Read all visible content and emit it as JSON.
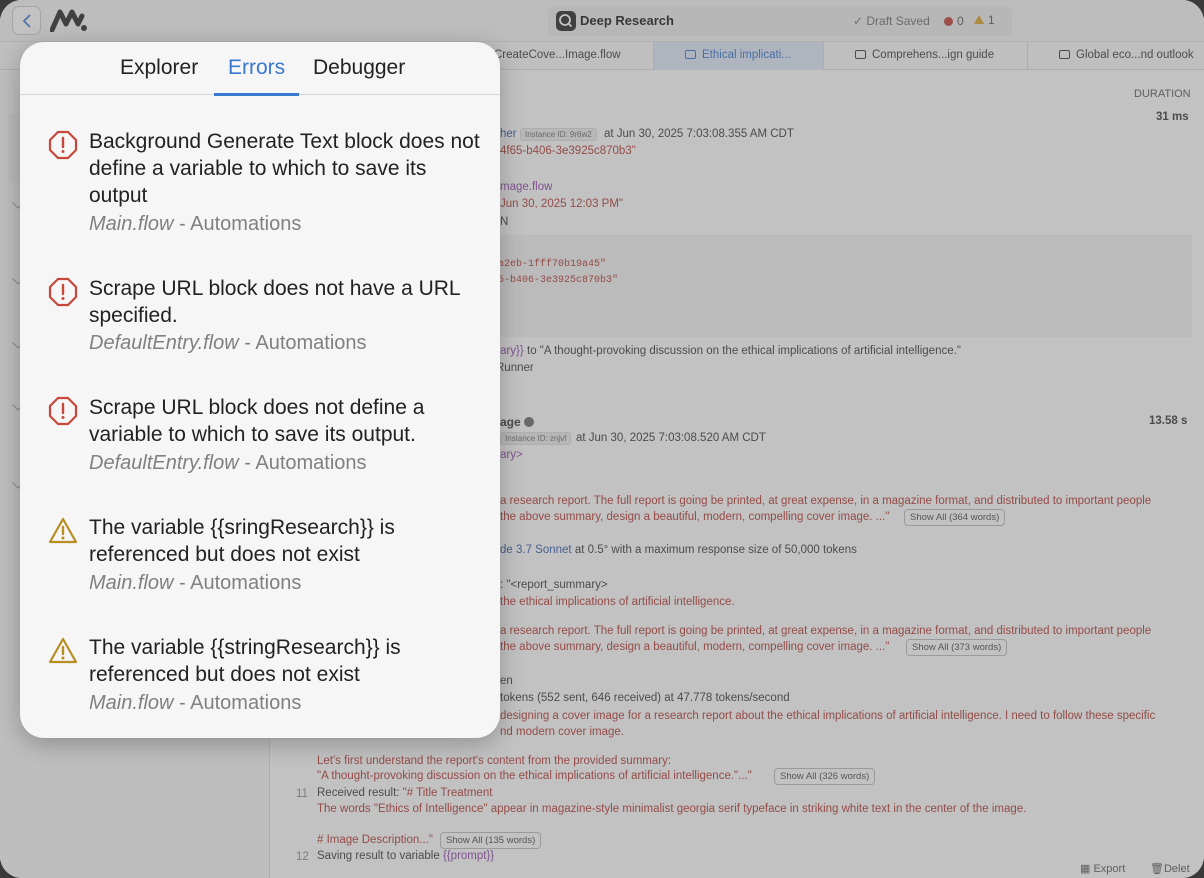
{
  "window": {
    "title": "Deep Research",
    "draft_status": "Draft Saved",
    "error_count": "0",
    "warning_count": "1"
  },
  "file_tabs": [
    {
      "label": "CreateCove...Image.flow",
      "active": false
    },
    {
      "label": "Ethical implicati...",
      "active": true
    },
    {
      "label": "Comprehens...ign guide",
      "active": false
    },
    {
      "label": "Global eco...nd outlook",
      "active": false
    }
  ],
  "log": {
    "duration_header": "DURATION",
    "entry1": {
      "duration": "31 ms",
      "runner_fragment": "her",
      "instance_badge": "Instance ID: 9r6w2",
      "timestamp": "at Jun 30, 2025 7:03:08.355 AM CDT",
      "id_fragment": "4f65-b406-3e3925c870b3\"",
      "flow_fragment": "mage.flow",
      "date_fragment": "Jun 30, 2025 12:03 PM\"",
      "n_fragment": "N",
      "json_line1": "a2eb-1fff70b19a45\"",
      "json_line2": "5-b406-3e3925c870b3\"",
      "set_var": "ary}}",
      "set_text": "to \"A thought-provoking discussion on the ethical implications of artificial intelligence.\"",
      "runner": "Runner"
    },
    "entry2": {
      "title_fragment": "age",
      "duration": "13.58 s",
      "instance_badge": "Instance ID: znjvf",
      "timestamp": "at Jun 30, 2025 7:03:08.520 AM CDT",
      "summary_tag": "ary>",
      "prompt1_line1": "a research report. The full report is going be printed, at great expense, in a magazine format, and distributed to important people",
      "prompt1_line2": "the above summary, design a beautiful, modern, compelling cover image. ...\"",
      "showall1": "Show All (364 words)",
      "model_name": "de 3.7 Sonnet",
      "model_text": "at 0.5° with a maximum response size of 50,000 tokens",
      "report_summary": ": \"<report_summary>",
      "ethics_line": "the ethical implications of artificial intelligence.",
      "prompt2_line1": "a research report. The full report is going be printed, at great expense, in a magazine format, and distributed to important people",
      "prompt2_line2": "the above summary, design a beautiful, modern, compelling cover image. ...\"",
      "showall2": "Show All (373 words)",
      "en_fragment": "en",
      "tokens_line": "tokens (552 sent, 646 received) at 47.778 tokens/second",
      "designing_line": "designing a cover image for a research report about the ethical implications of artificial intelligence. I need to follow these specific",
      "modern_line": "nd modern cover image.",
      "understand_line": "Let's first understand the report's content from the provided summary:",
      "quote_line": "\"A thought-provoking discussion on the ethical implications of artificial intelligence.\"...\"",
      "showall3": "Show All (326 words)",
      "line11_num": "11",
      "received_label": "Received result:",
      "received_value": "\"# Title Treatment",
      "words_line": "The words \"Ethics of Intelligence\" appear in magazine-style minimalist georgia serif typeface in striking white text in the center of the image.",
      "image_desc": "# Image Description...\"",
      "showall4": "Show All (135 words)",
      "line12_num": "12",
      "saving_label": "Saving result to variable",
      "saving_var": "{{prompt}}"
    },
    "export_label": "Export",
    "delete_label": "Delet"
  },
  "popover": {
    "tabs": [
      "Explorer",
      "Errors",
      "Debugger"
    ],
    "active_tab": "Errors",
    "items": [
      {
        "kind": "error",
        "message": "Background Generate Text block does not define a variable to which to save its output",
        "file": "Main.flow",
        "location": " - Automations"
      },
      {
        "kind": "error",
        "message": "Scrape URL block does not have a URL specified.",
        "file": "DefaultEntry.flow",
        "location": " - Automations"
      },
      {
        "kind": "error",
        "message": "Scrape URL block does not define a variable to which to save its output.",
        "file": "DefaultEntry.flow",
        "location": " - Automations"
      },
      {
        "kind": "warning",
        "message": "The variable {{sringResearch}} is referenced but does not exist",
        "file": "Main.flow",
        "location": " - Automations"
      },
      {
        "kind": "warning",
        "message": "The variable {{stringResearch}} is referenced but does not exist",
        "file": "Main.flow",
        "location": " - Automations"
      }
    ]
  },
  "colors": {
    "error": "#c8473b",
    "warning": "#b98f22",
    "accent": "#3a78d0"
  },
  "icons": {
    "error": "octagon-alert-icon",
    "warning": "triangle-alert-icon"
  }
}
